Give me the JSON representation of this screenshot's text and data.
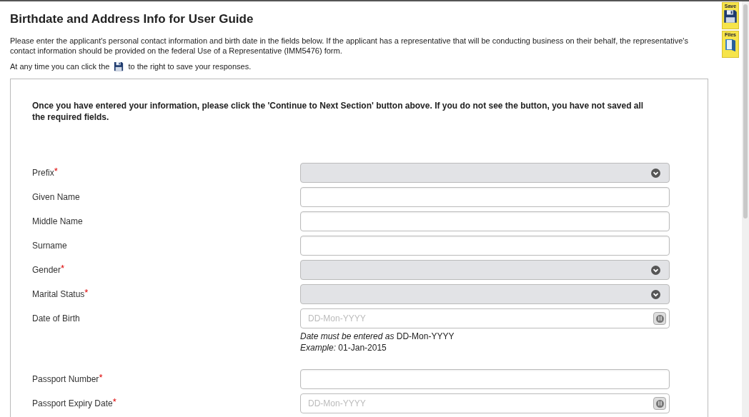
{
  "title": "Birthdate and Address Info for User Guide",
  "intro": "Please enter the applicant's personal contact information and birth date in the fields below. If the applicant has a representative that will be conducting business on their behalf, the representative's contact information should be provided on the federal Use of a Representative (IMM5476) form.",
  "save_hint": {
    "before": "At any time you can click the",
    "after": "to the right to save your responses."
  },
  "form": {
    "notice": "Once you have entered your information, please click the 'Continue to Next Section' button above. If you do not see the button, you have not saved all the required fields.",
    "required_mark": "*",
    "fields": [
      {
        "label": "Prefix",
        "kind": "select",
        "required": true
      },
      {
        "label": "Given Name",
        "kind": "text",
        "required": false
      },
      {
        "label": "Middle Name",
        "kind": "text",
        "required": false
      },
      {
        "label": "Surname",
        "kind": "text",
        "required": false
      },
      {
        "label": "Gender",
        "kind": "select",
        "required": true
      },
      {
        "label": "Marital Status",
        "kind": "select",
        "required": true
      },
      {
        "label": "Date of Birth",
        "kind": "date",
        "required": false,
        "placeholder": "DD-Mon-YYYY",
        "hints": [
          "*Date must be entered as* DD-Mon-YYYY",
          "*Example:* 01-Jan-2015"
        ]
      },
      {
        "label": "Passport Number",
        "kind": "text",
        "required": true
      },
      {
        "label": "Passport Expiry Date",
        "kind": "date",
        "required": true,
        "placeholder": "DD-Mon-YYYY"
      }
    ]
  },
  "toolbar": [
    {
      "label": "Save",
      "kind": "save"
    },
    {
      "label": "Files",
      "kind": "files"
    }
  ]
}
